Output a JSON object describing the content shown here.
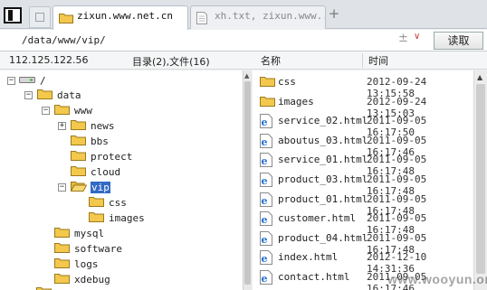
{
  "tabs": {
    "active_label": "zixun.www.net.cn",
    "inactive_label": "xh.txt, zixun.www....",
    "new_tab_symbol": "+"
  },
  "address": {
    "path": "/data/www/vip/",
    "read_button": "读取",
    "add_symbol": "±",
    "dropdown_symbol": "∨"
  },
  "info": {
    "ip": "112.125.122.56",
    "counts": "目录(2),文件(16)",
    "col_name": "名称",
    "col_time": "时间"
  },
  "tree": [
    {
      "label": "/",
      "icon": "drive-icon",
      "expander": "-"
    },
    {
      "label": "data",
      "icon": "folder-icon",
      "expander": "-"
    },
    {
      "label": "www",
      "icon": "folder-icon",
      "expander": "-"
    },
    {
      "label": "news",
      "icon": "folder-icon",
      "expander": "+"
    },
    {
      "label": "bbs",
      "icon": "folder-icon",
      "expander": ""
    },
    {
      "label": "protect",
      "icon": "folder-icon",
      "expander": ""
    },
    {
      "label": "cloud",
      "icon": "folder-icon",
      "expander": ""
    },
    {
      "label": "vip",
      "icon": "folder-open-icon",
      "expander": "-",
      "selected": true
    },
    {
      "label": "css",
      "icon": "folder-icon",
      "expander": ""
    },
    {
      "label": "images",
      "icon": "folder-icon",
      "expander": ""
    },
    {
      "label": "mysql",
      "icon": "folder-icon",
      "expander": ""
    },
    {
      "label": "software",
      "icon": "folder-icon",
      "expander": ""
    },
    {
      "label": "logs",
      "icon": "folder-icon",
      "expander": ""
    },
    {
      "label": "xdebug",
      "icon": "folder-icon",
      "expander": ""
    }
  ],
  "files": [
    {
      "name": "css",
      "time": "2012-09-24 13:15:58",
      "type": "folder"
    },
    {
      "name": "images",
      "time": "2012-09-24 13:15:03",
      "type": "folder"
    },
    {
      "name": "service_02.html",
      "time": "2011-09-05 16:17:50",
      "type": "html"
    },
    {
      "name": "aboutus_03.html",
      "time": "2011-09-05 16:17:46",
      "type": "html"
    },
    {
      "name": "service_01.html",
      "time": "2011-09-05 16:17:48",
      "type": "html"
    },
    {
      "name": "product_03.html",
      "time": "2011-09-05 16:17:48",
      "type": "html"
    },
    {
      "name": "product_01.html",
      "time": "2011-09-05 16:17:48",
      "type": "html"
    },
    {
      "name": "customer.html",
      "time": "2011-09-05 16:17:48",
      "type": "html"
    },
    {
      "name": "product_04.html",
      "time": "2011-09-05 16:17:48",
      "type": "html"
    },
    {
      "name": "index.html",
      "time": "2012-12-10 14:31:36",
      "type": "html"
    },
    {
      "name": "contact.html",
      "time": "2011-09-05 16:17:46",
      "type": "html"
    }
  ],
  "watermark": "www.wooyun.org",
  "colors": {
    "selection": "#316ac5",
    "folder": "#f3c84d",
    "ie_blue": "#1f6fd1"
  }
}
